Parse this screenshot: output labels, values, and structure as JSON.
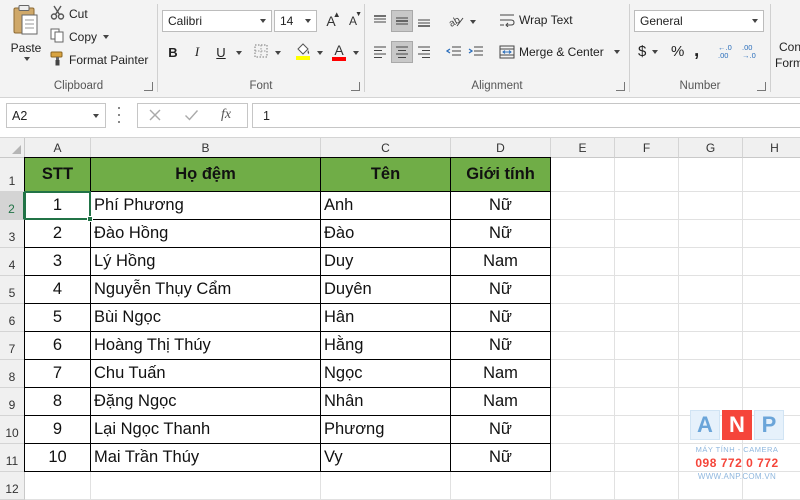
{
  "ribbon": {
    "clipboard": {
      "label": "Clipboard",
      "paste": "Paste",
      "cut": "Cut",
      "copy": "Copy",
      "format_painter": "Format Painter"
    },
    "font": {
      "label": "Font",
      "font_name": "Calibri",
      "font_size": "14",
      "bold": "B",
      "italic": "I",
      "underline": "U",
      "font_color_glyph": "A",
      "grow_glyph": "A",
      "shrink_glyph": "A"
    },
    "alignment": {
      "label": "Alignment",
      "wrap_text": "Wrap Text",
      "merge_center": "Merge & Center"
    },
    "number": {
      "label": "Number",
      "format": "General",
      "currency": "$",
      "percent": "%",
      "comma": ",",
      "inc_decimal": "←.0 .00",
      "dec_decimal": ".00 →.0"
    },
    "styles": {
      "cond_line1": "Con",
      "cond_line2": "Form"
    }
  },
  "formula_bar": {
    "name_box": "A2",
    "fx": "fx",
    "value": "1"
  },
  "sheet": {
    "columns": [
      "A",
      "B",
      "C",
      "D",
      "E",
      "F",
      "G",
      "H"
    ],
    "row_numbers": [
      "1",
      "2",
      "3",
      "4",
      "5",
      "6",
      "7",
      "8",
      "9",
      "10",
      "11",
      "12"
    ],
    "header": [
      "STT",
      "Họ đệm",
      "Tên",
      "Giới tính"
    ],
    "rows": [
      [
        "1",
        "Phí Phương",
        "Anh",
        "Nữ"
      ],
      [
        "2",
        "Đào Hồng",
        "Đào",
        "Nữ"
      ],
      [
        "3",
        "Lý Hồng",
        "Duy",
        "Nam"
      ],
      [
        "4",
        "Nguyễn Thụy Cẩm",
        "Duyên",
        "Nữ"
      ],
      [
        "5",
        "Bùi Ngọc",
        "Hân",
        "Nữ"
      ],
      [
        "6",
        "Hoàng Thị Thúy",
        "Hằng",
        "Nữ"
      ],
      [
        "7",
        "Chu Tuấn",
        "Ngọc",
        "Nam"
      ],
      [
        "8",
        "Đặng Ngọc",
        "Nhân",
        "Nam"
      ],
      [
        "9",
        "Lại Ngọc Thanh",
        "Phương",
        "Nữ"
      ],
      [
        "10",
        "Mai Trần Thúy",
        "Vy",
        "Nữ"
      ]
    ],
    "selected_cell": "A2"
  },
  "watermark": {
    "letters": [
      "A",
      "N",
      "P"
    ],
    "tagline": "MÁY TÍNH - CAMERA",
    "phone": "098 772 0 772",
    "website": "WWW.ANP.COM.VN"
  },
  "colors": {
    "header_fill": "#70ad47",
    "excel_green": "#217346",
    "ribbon_bg": "#f3f3f3",
    "watermark_red": "#f5453a",
    "watermark_blue": "#6ba5d9"
  }
}
